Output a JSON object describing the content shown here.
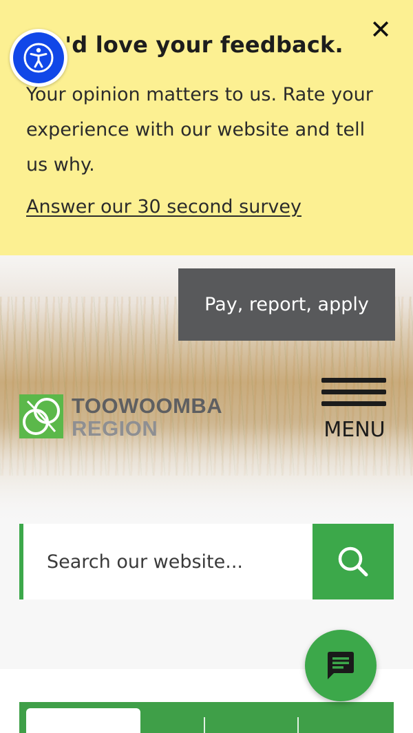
{
  "feedback": {
    "title": "We'd love your feedback.",
    "body": "Your opinion matters to us. Rate your experience with our website and tell us why.",
    "link": "Answer our 30 second survey",
    "close_glyph": "✕"
  },
  "accessibility": {
    "icon": "accessibility-person-icon",
    "color": "#1147e8"
  },
  "header": {
    "pay_button": "Pay, report, apply",
    "logo": {
      "line1": "TOOWOOMBA",
      "line2": "REGION",
      "mark_color": "#5bb84a"
    },
    "menu_label": "MENU"
  },
  "search": {
    "placeholder": "Search our website...",
    "button_icon": "search-icon",
    "accent": "#3ca84a"
  },
  "chat": {
    "icon": "chat-icon"
  },
  "tabs": {
    "count": 4,
    "active_index": 0,
    "color": "#3f9f48"
  }
}
